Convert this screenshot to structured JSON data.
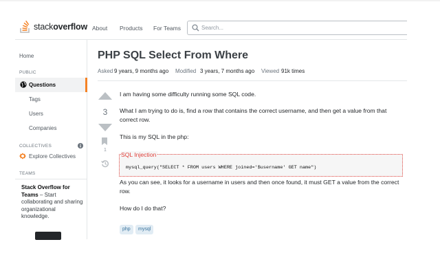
{
  "header": {
    "logo_prefix": "stack",
    "logo_suffix": "overflow",
    "nav": [
      "About",
      "Products",
      "For Teams"
    ],
    "search_placeholder": "Search..."
  },
  "sidebar": {
    "home": "Home",
    "public_label": "PUBLIC",
    "questions": "Questions",
    "tags": "Tags",
    "users": "Users",
    "companies": "Companies",
    "collectives_label": "COLLECTIVES",
    "explore_collectives": "Explore Collectives",
    "teams_label": "TEAMS",
    "teams_title": "Stack Overflow for Teams",
    "teams_dash": " – ",
    "teams_text": "Start collaborating and sharing organizational knowledge."
  },
  "question": {
    "title": "PHP SQL Select From Where",
    "asked_label": "Asked",
    "asked_value": "9 years, 9 months ago",
    "modified_label": "Modified",
    "modified_value": "3 years, 7 months ago",
    "viewed_label": "Viewed",
    "viewed_value": "91k times",
    "score": "3",
    "bookmarks": "1",
    "body": [
      "I am having some difficulty running some SQL code.",
      "What I am trying to do is, find a row that contains the correct username, and then get a value from that correct row.",
      "This is my SQL in the php:",
      "As you can see, it looks for a username in users and then once found, it must GET a value from the correct row.",
      "How do I do that?"
    ],
    "code_label": "SQL Injection",
    "code": "mysql_query(\"SELECT * FROM users WHERE joined='$username' GET name\")",
    "tags": [
      "php",
      "mysql"
    ]
  },
  "colors": {
    "accent": "#f48225",
    "link": "#39739d",
    "tag_bg": "#e1ecf4",
    "highlight": "#e0403a"
  },
  "icons": [
    "stackoverflow-logo-icon",
    "search-icon",
    "globe-icon",
    "info-icon",
    "collectives-icon",
    "upvote-arrow-icon",
    "downvote-arrow-icon",
    "bookmark-icon",
    "history-icon"
  ]
}
